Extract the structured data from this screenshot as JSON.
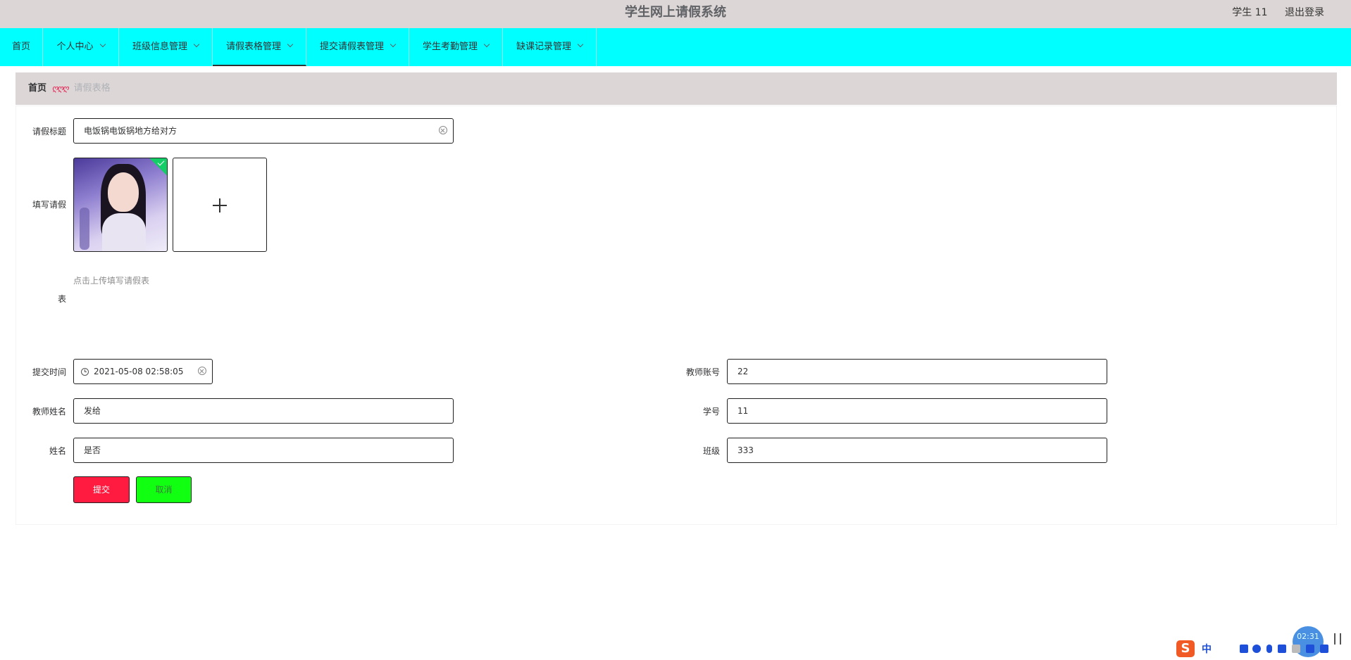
{
  "header": {
    "title": "学生网上请假系统",
    "user": "学生 11",
    "logout": "退出登录"
  },
  "nav": {
    "items": [
      {
        "label": "首页",
        "dropdown": false
      },
      {
        "label": "个人中心",
        "dropdown": true
      },
      {
        "label": "班级信息管理",
        "dropdown": true
      },
      {
        "label": "请假表格管理",
        "dropdown": true,
        "active": true
      },
      {
        "label": "提交请假表管理",
        "dropdown": true
      },
      {
        "label": "学生考勤管理",
        "dropdown": true
      },
      {
        "label": "缺课记录管理",
        "dropdown": true
      }
    ]
  },
  "breadcrumb": {
    "home": "首页",
    "separator": "ღღღ",
    "current": "请假表格"
  },
  "form": {
    "title_label": "请假标题",
    "title_value": "电饭锅电饭锅地方给对方",
    "upload_label_line1": "填写请假",
    "upload_label_line2": "表",
    "upload_tip": "点击上传填写请假表",
    "submit_time_label": "提交时间",
    "submit_time_value": "2021-05-08 02:58:05",
    "teacher_account_label": "教师账号",
    "teacher_account_value": "22",
    "teacher_name_label": "教师姓名",
    "teacher_name_value": "发给",
    "student_no_label": "学号",
    "student_no_value": "11",
    "name_label": "姓名",
    "name_value": "是否",
    "class_label": "班级",
    "class_value": "333",
    "submit_button": "提交",
    "cancel_button": "取消"
  },
  "taskbar": {
    "ime_logo": "S",
    "ime_lang": "中",
    "clock": "02:31"
  },
  "colors": {
    "topbar": "#dcd6d6",
    "navbar": "#00ffff",
    "submit": "#ff1a3f",
    "cancel": "#11ff11",
    "breadcrumb_separator": "#e8174a"
  }
}
